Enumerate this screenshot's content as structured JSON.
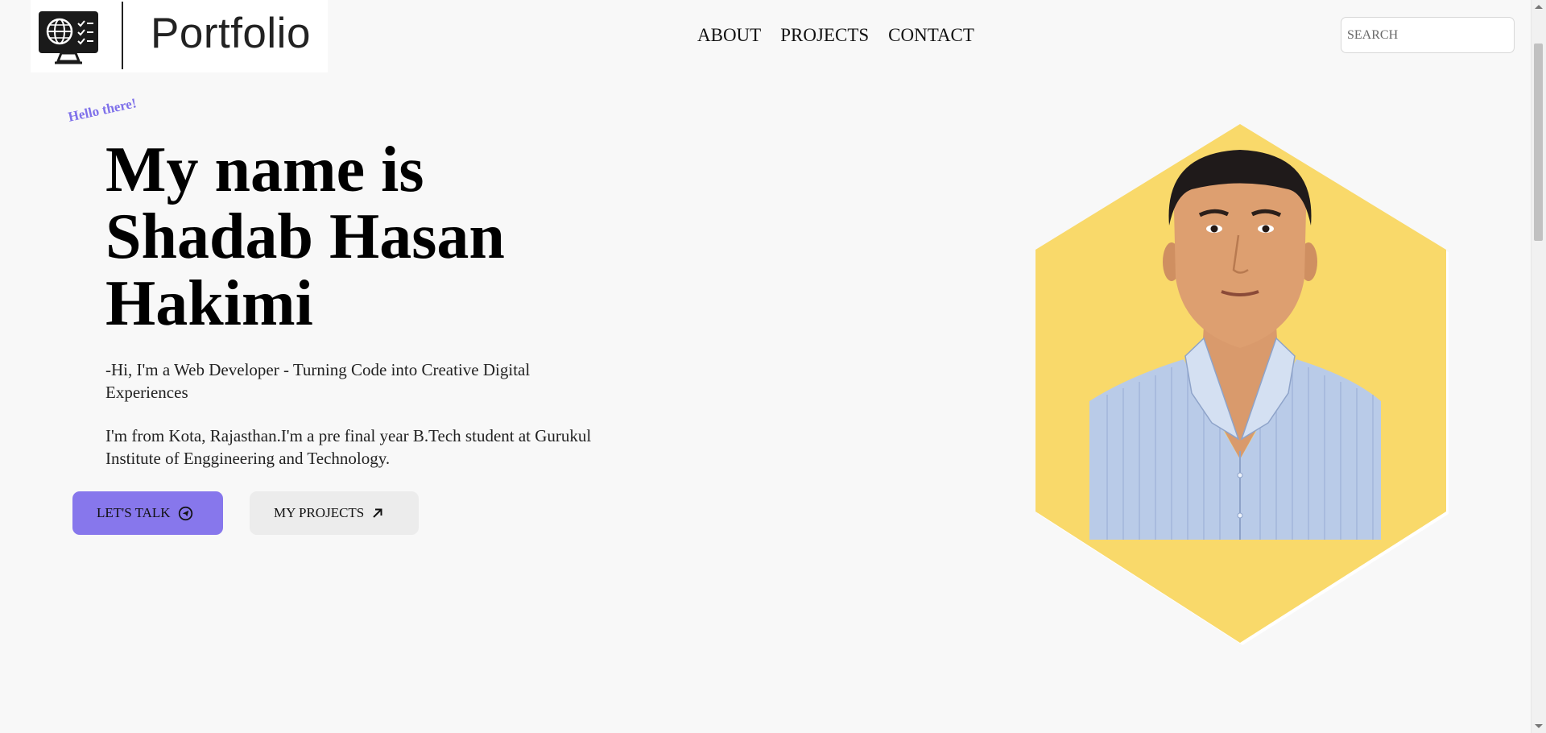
{
  "header": {
    "logo_text": "Portfolio",
    "logo_icon": "monitor-globe-checklist-icon",
    "nav": [
      {
        "label": "ABOUT"
      },
      {
        "label": "PROJECTS"
      },
      {
        "label": "CONTACT"
      }
    ],
    "search": {
      "placeholder": "SEARCH",
      "value": ""
    }
  },
  "hero": {
    "greeting": "Hello there!",
    "title_lines": [
      "My name is",
      "Shadab Hasan",
      "Hakimi"
    ],
    "tagline": "-Hi, I'm a Web Developer - Turning Code into Creative Digital Experiences",
    "bio": "I'm from Kota, Rajasthan.I'm a pre final year B.Tech student at Gurukul Institute of Enggineering and Technology.",
    "buttons": {
      "talk": {
        "label": "LET'S TALK",
        "icon": "send-circle-icon"
      },
      "projects": {
        "label": "MY PROJECTS",
        "icon": "arrow-up-right-icon"
      }
    },
    "portrait": {
      "shape": "hexagon",
      "background_color": "#f9d96a"
    }
  },
  "colors": {
    "accent": "#8777ec",
    "greeting": "#7f71ea",
    "hex": "#f9d96a",
    "secondary_button": "#ececec"
  }
}
